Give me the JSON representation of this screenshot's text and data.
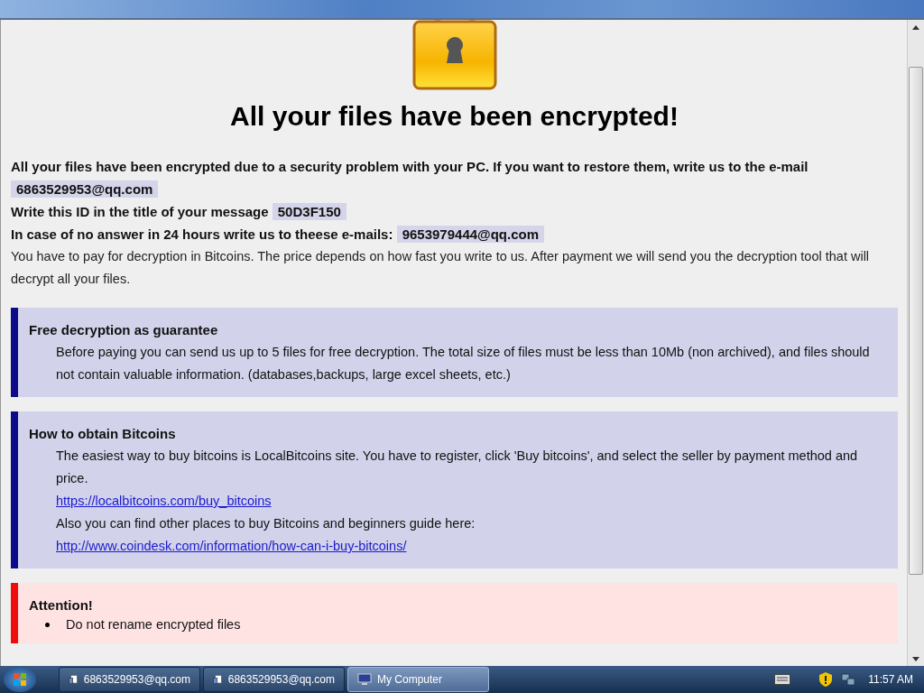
{
  "heading": "All your files have been encrypted!",
  "contact_lines": [
    {
      "text": "All your files have been encrypted due to a security problem with your PC. If you want to restore them, write us to the e-mail",
      "highlight": "6863529953@qq.com"
    },
    {
      "text": "Write this ID in the title of your message",
      "highlight": "50D3F150"
    },
    {
      "text": "In case of no answer in 24 hours write us to theese e-mails:",
      "highlight": "9653979444@qq.com"
    }
  ],
  "payment_note": "You have to pay for decryption in Bitcoins. The price depends on how fast you write to us. After payment we will send you the decryption tool that will decrypt all your files.",
  "sections": [
    {
      "kind": "info",
      "title": "Free decryption as guarantee",
      "items": [
        {
          "kind": "text",
          "text": "Before paying you can send us up to 5 files for free decryption. The total size of files must be less than 10Mb (non archived), and files should not contain valuable information. (databases,backups, large excel sheets, etc.)"
        }
      ]
    },
    {
      "kind": "info",
      "title": "How to obtain Bitcoins",
      "items": [
        {
          "kind": "text",
          "text": "The easiest way to buy bitcoins is LocalBitcoins site. You have to register, click 'Buy bitcoins', and select the seller by payment method and price."
        },
        {
          "kind": "link",
          "text": "https://localbitcoins.com/buy_bitcoins"
        },
        {
          "kind": "text",
          "text": "Also you can find other places to buy Bitcoins and beginners guide here:"
        },
        {
          "kind": "link",
          "text": "http://www.coindesk.com/information/how-can-i-buy-bitcoins/"
        }
      ]
    },
    {
      "kind": "warning",
      "title": "Attention!",
      "items": [
        {
          "kind": "bullet",
          "text": "Do not rename encrypted files"
        }
      ]
    }
  ],
  "taskbar": {
    "buttons": [
      {
        "kind": "note",
        "label": "6863529953@qq.com",
        "selected": false
      },
      {
        "kind": "note",
        "label": "6863529953@qq.com",
        "selected": false
      },
      {
        "kind": "computer",
        "label": "My Computer",
        "selected": true
      }
    ],
    "clock": "11:57 AM"
  }
}
